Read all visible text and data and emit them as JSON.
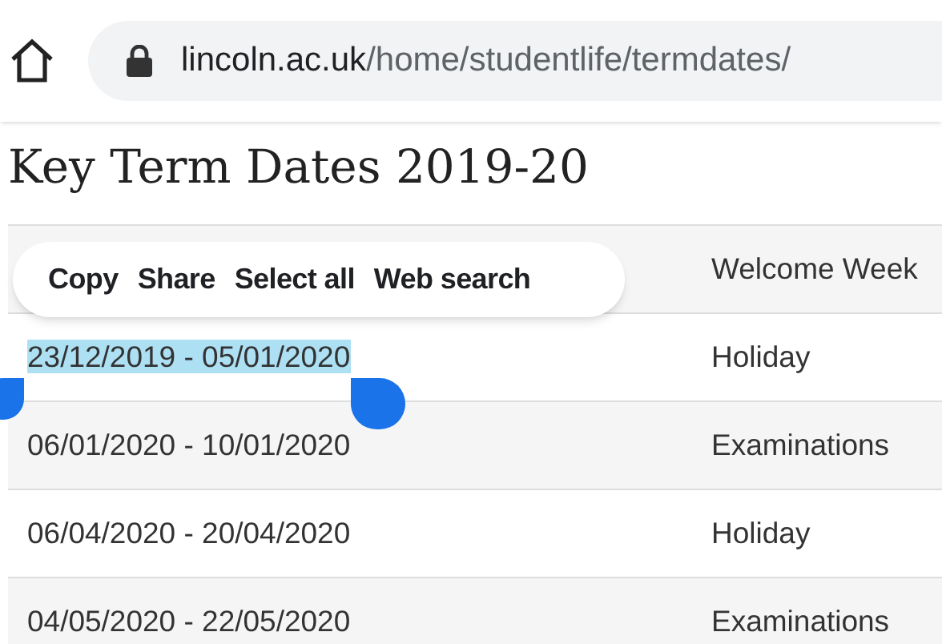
{
  "browser": {
    "url_host": "lincoln.ac.uk",
    "url_path": "/home/studentlife/termdates/"
  },
  "page": {
    "title": "Key Term Dates 2019-20"
  },
  "context_menu": {
    "items": [
      "Copy",
      "Share",
      "Select all",
      "Web search"
    ]
  },
  "table": {
    "rows": [
      {
        "event": "Welcome Week"
      },
      {
        "dates": "23/12/2019 - 05/01/2020",
        "event": "Holiday",
        "selected": true
      },
      {
        "dates": "06/01/2020 - 10/01/2020",
        "event": "Examinations",
        "selected": false
      },
      {
        "dates": "06/04/2020 - 20/04/2020",
        "event": "Holiday",
        "selected": false
      },
      {
        "dates": "04/05/2020 - 22/05/2020",
        "event": "Examinations",
        "selected": false
      }
    ]
  }
}
